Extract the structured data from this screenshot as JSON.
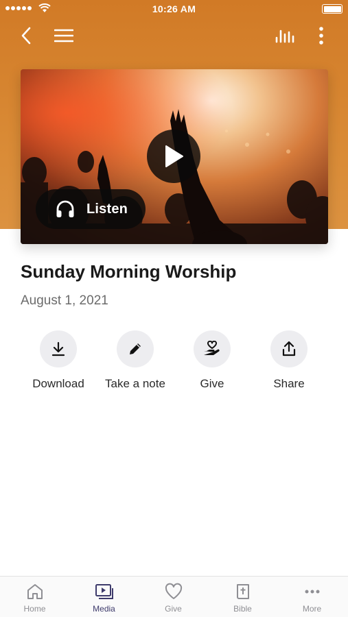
{
  "status_bar": {
    "time": "10:26 AM"
  },
  "nav": {
    "back_icon": "chevron-left-icon",
    "menu_icon": "hamburger-icon",
    "audio_icon": "audio-bars-icon",
    "more_icon": "vertical-dots-icon"
  },
  "hero": {
    "listen_label": "Listen",
    "play_icon": "play-icon",
    "headphones_icon": "headphones-icon"
  },
  "content": {
    "title": "Sunday Morning Worship",
    "date": "August 1, 2021"
  },
  "actions": [
    {
      "label": "Download",
      "icon": "download-icon"
    },
    {
      "label": "Take a note",
      "icon": "pencil-icon"
    },
    {
      "label": "Give",
      "icon": "hand-heart-icon"
    },
    {
      "label": "Share",
      "icon": "share-icon"
    }
  ],
  "tabs": [
    {
      "label": "Home",
      "icon": "home-icon",
      "active": false
    },
    {
      "label": "Media",
      "icon": "media-icon",
      "active": true
    },
    {
      "label": "Give",
      "icon": "heart-icon",
      "active": false
    },
    {
      "label": "Bible",
      "icon": "bible-icon",
      "active": false
    },
    {
      "label": "More",
      "icon": "more-dots-icon",
      "active": false
    }
  ],
  "colors": {
    "header": "#d17a26",
    "active_tab": "#3d3a6b",
    "inactive_tab": "#8e8e93",
    "action_circle": "#ededf0"
  }
}
